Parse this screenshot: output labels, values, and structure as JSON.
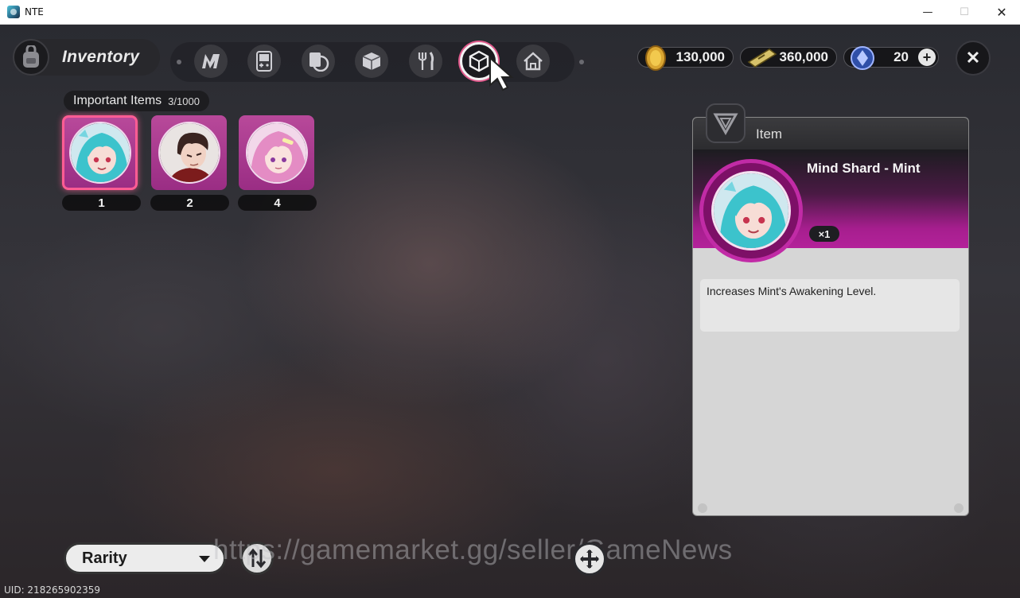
{
  "window": {
    "title": "NTE",
    "minimize": "—",
    "maximize": "☐",
    "close": "✕"
  },
  "header": {
    "title": "Inventory"
  },
  "tabs": [
    {
      "name": "tab-n-items",
      "icon": "n-logo-icon"
    },
    {
      "name": "tab-gadgets",
      "icon": "handheld-console-icon"
    },
    {
      "name": "tab-cards",
      "icon": "cards-icon"
    },
    {
      "name": "tab-materials",
      "icon": "cube-icon"
    },
    {
      "name": "tab-food",
      "icon": "fork-knife-icon"
    },
    {
      "name": "tab-important",
      "icon": "gem-cube-icon",
      "active": true
    },
    {
      "name": "tab-home",
      "icon": "house-icon"
    }
  ],
  "currencies": [
    {
      "icon": "gold-coin-icon",
      "value": "130,000"
    },
    {
      "icon": "ticket-icon",
      "value": "360,000"
    },
    {
      "icon": "crystal-icon",
      "value": "20",
      "plus": "+"
    }
  ],
  "close_button": "✕",
  "section": {
    "label": "Important Items",
    "count": "3/1000"
  },
  "items": [
    {
      "qty": "1",
      "character": "Mint",
      "selected": true
    },
    {
      "qty": "2",
      "character": "dark-haired male"
    },
    {
      "qty": "4",
      "character": "pink-haired girl"
    }
  ],
  "detail": {
    "header": "Item",
    "name": "Mind Shard - Mint",
    "qty": "×1",
    "description": "Increases Mint's Awakening Level."
  },
  "sort": {
    "label": "Rarity"
  },
  "watermark": "https://gamemarket.gg/seller/GameNews",
  "uid": "UID: 218265902359",
  "colors": {
    "rarity_purple": "#b8499a",
    "selected_pink": "#ff5c94",
    "panel_magenta": "#a61e8e"
  }
}
